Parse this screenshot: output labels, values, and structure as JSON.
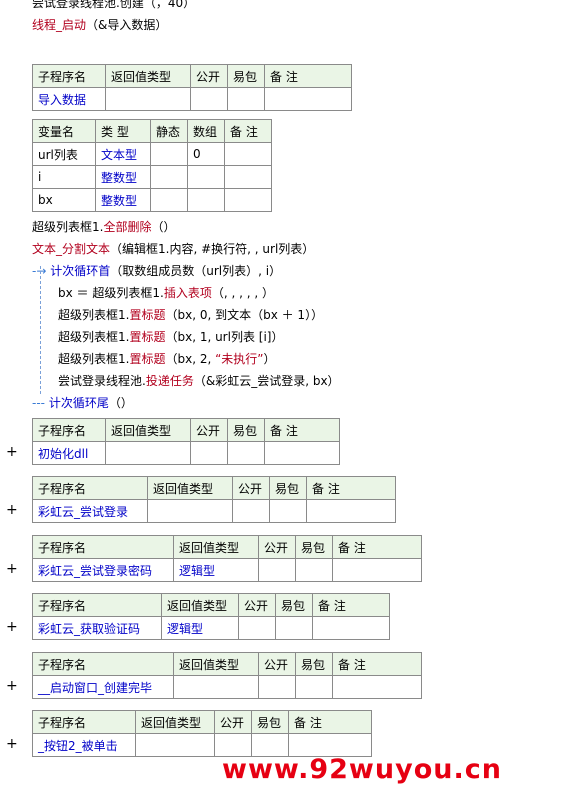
{
  "code_top": {
    "line1": "尝试登录线程池.创建（，40）",
    "line2_a": "线程_启动",
    "line2_b": "（&导入数据）"
  },
  "sub1": {
    "headers": [
      "子程序名",
      "返回值类型",
      "公开",
      "易包",
      "备 注"
    ],
    "name": "导入数据"
  },
  "vars": {
    "headers": [
      "变量名",
      "类 型",
      "静态",
      "数组",
      "备 注"
    ],
    "rows": [
      {
        "name": "url列表",
        "type": "文本型",
        "array": "0"
      },
      {
        "name": "i",
        "type": "整数型",
        "array": ""
      },
      {
        "name": "bx",
        "type": "整数型",
        "array": ""
      }
    ]
  },
  "code_body": {
    "l1_a": "超级列表框1.",
    "l1_b": "全部删除",
    "l1_c": "（）",
    "l2_a": "文本_分割文本",
    "l2_b": "（编辑框1.内容, #换行符, , url列表）",
    "l3_a": "计次循环首",
    "l3_b": "（取数组成员数（url列表）, i）",
    "l4_a": "bx ＝ 超级列表框1.",
    "l4_b": "插入表项",
    "l4_c": "（, , , , , ）",
    "l5_a": "超级列表框1.",
    "l5_b": "置标题",
    "l5_c": "（bx, 0, 到文本（bx ＋ 1））",
    "l6_a": "超级列表框1.",
    "l6_b": "置标题",
    "l6_c": "（bx, 1, url列表 [i]）",
    "l7_a": "超级列表框1.",
    "l7_b": "置标题",
    "l7_c": "（bx, 2, ",
    "l7_d": "“未执行”",
    "l7_e": "）",
    "l8_a": "尝试登录线程池.",
    "l8_b": "投递任务",
    "l8_c": "（&彩虹云_尝试登录, bx）",
    "l9_a": "计次循环尾",
    "l9_b": "（）"
  },
  "subs": [
    {
      "headers": [
        "子程序名",
        "返回值类型",
        "公开",
        "易包",
        "备 注"
      ],
      "name": "初始化dll",
      "type": ""
    },
    {
      "headers": [
        "子程序名",
        "返回值类型",
        "公开",
        "易包",
        "备 注"
      ],
      "name": "彩虹云_尝试登录",
      "type": ""
    },
    {
      "headers": [
        "子程序名",
        "返回值类型",
        "公开",
        "易包",
        "备 注"
      ],
      "name": "彩虹云_尝试登录密码",
      "type": "逻辑型"
    },
    {
      "headers": [
        "子程序名",
        "返回值类型",
        "公开",
        "易包",
        "备 注"
      ],
      "name": "彩虹云_获取验证码",
      "type": "逻辑型"
    },
    {
      "headers": [
        "子程序名",
        "返回值类型",
        "公开",
        "易包",
        "备 注"
      ],
      "name": "__启动窗口_创建完毕",
      "type": ""
    },
    {
      "headers": [
        "子程序名",
        "返回值类型",
        "公开",
        "易包",
        "备 注"
      ],
      "name": "_按钮2_被单击",
      "type": ""
    }
  ],
  "expand_symbol": "+",
  "loop_arrow": "-→",
  "loop_end": "---",
  "watermark": "www.92wuyou.cn"
}
